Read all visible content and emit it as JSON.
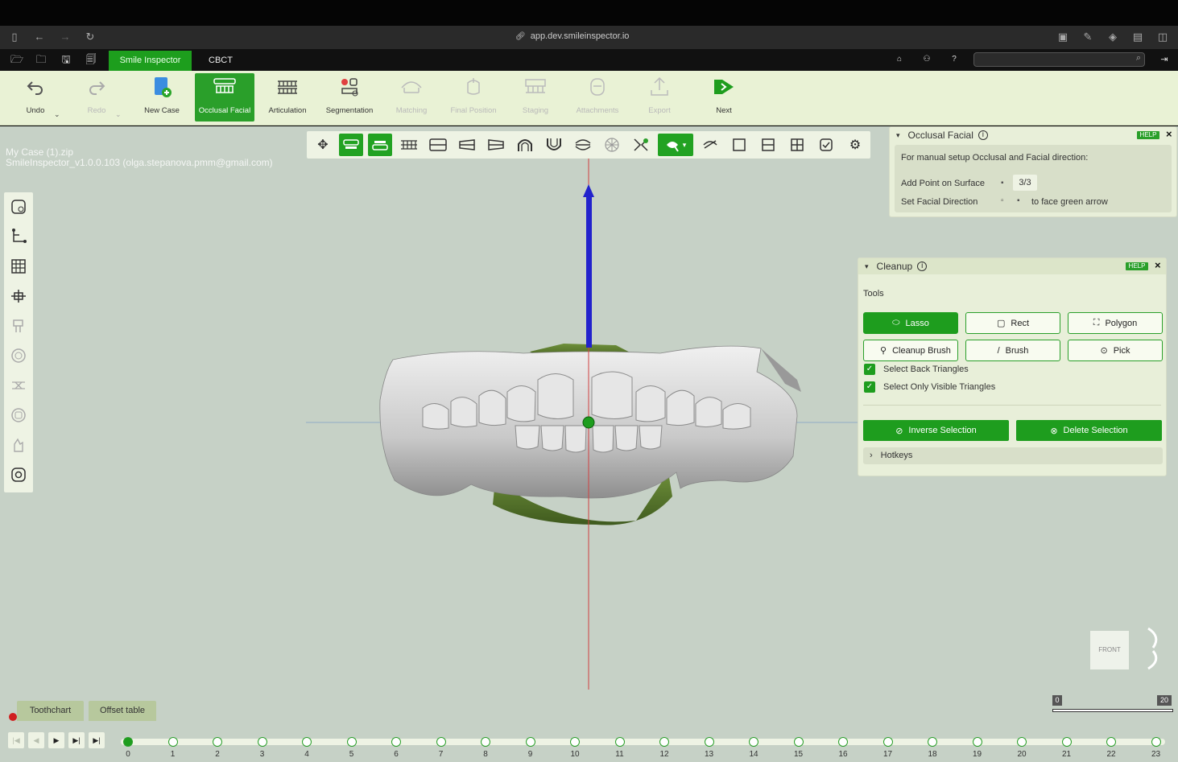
{
  "browser": {
    "url": "app.dev.smileinspector.io"
  },
  "app_tabs": {
    "active": "Smile Inspector",
    "other": "CBCT"
  },
  "ribbon": [
    {
      "label": "Undo",
      "icon": "undo-icon",
      "state": "normal"
    },
    {
      "label": "Redo",
      "icon": "redo-icon",
      "state": "disabled"
    },
    {
      "label": "New Case",
      "icon": "new-case-icon",
      "state": "normal"
    },
    {
      "label": "Occlusal Facial",
      "icon": "occlusal-facial-icon",
      "state": "active"
    },
    {
      "label": "Articulation",
      "icon": "articulation-icon",
      "state": "normal"
    },
    {
      "label": "Segmentation",
      "icon": "segmentation-icon",
      "state": "normal"
    },
    {
      "label": "Matching",
      "icon": "matching-icon",
      "state": "disabled"
    },
    {
      "label": "Final Position",
      "icon": "final-position-icon",
      "state": "disabled"
    },
    {
      "label": "Staging",
      "icon": "staging-icon",
      "state": "disabled"
    },
    {
      "label": "Attachments",
      "icon": "attachments-icon",
      "state": "disabled"
    },
    {
      "label": "Export",
      "icon": "export-icon",
      "state": "disabled"
    },
    {
      "label": "Next",
      "icon": "next-icon",
      "state": "normal"
    }
  ],
  "case": {
    "file": "My Case (1).zip",
    "version": "SmileInspector_v1.0.0.103 (olga.stepanova.pmm@gmail.com)"
  },
  "occlusal_panel": {
    "title": "Occlusal Facial",
    "help": "HELP",
    "description": "For manual setup Occlusal and Facial direction:",
    "add_point_label": "Add Point on Surface",
    "add_point_value": "3/3",
    "facial_dir_label": "Set Facial Direction",
    "facial_dir_hint": "to face green arrow"
  },
  "cleanup_panel": {
    "title": "Cleanup",
    "help": "HELP",
    "tools_label": "Tools",
    "tools": [
      {
        "label": "Lasso",
        "icon": "lasso-icon",
        "active": true
      },
      {
        "label": "Rect",
        "icon": "rect-icon",
        "active": false
      },
      {
        "label": "Polygon",
        "icon": "polygon-icon",
        "active": false
      },
      {
        "label": "Cleanup Brush",
        "icon": "cleanup-brush-icon",
        "active": false
      },
      {
        "label": "Brush",
        "icon": "brush-icon",
        "active": false
      },
      {
        "label": "Pick",
        "icon": "pick-icon",
        "active": false
      }
    ],
    "check_back": "Select Back Triangles",
    "check_visible": "Select Only Visible Triangles",
    "inverse_btn": "Inverse Selection",
    "delete_btn": "Delete Selection",
    "hotkeys": "Hotkeys"
  },
  "view_cube": {
    "label": "FRONT"
  },
  "bottom_tabs": [
    "Toothchart",
    "Offset table"
  ],
  "zoom": {
    "min": "0",
    "max": "20"
  },
  "timeline": {
    "stages": [
      "0",
      "1",
      "2",
      "3",
      "4",
      "5",
      "6",
      "7",
      "8",
      "9",
      "10",
      "11",
      "12",
      "13",
      "14",
      "15",
      "16",
      "17",
      "18",
      "19",
      "20",
      "21",
      "22",
      "23"
    ],
    "current": 0
  },
  "colors": {
    "accent": "#2a9f2a",
    "viewport": "#c6d1c6",
    "panel": "#e8efd9",
    "arrow": "#2222cc",
    "axis": "#d04040"
  }
}
